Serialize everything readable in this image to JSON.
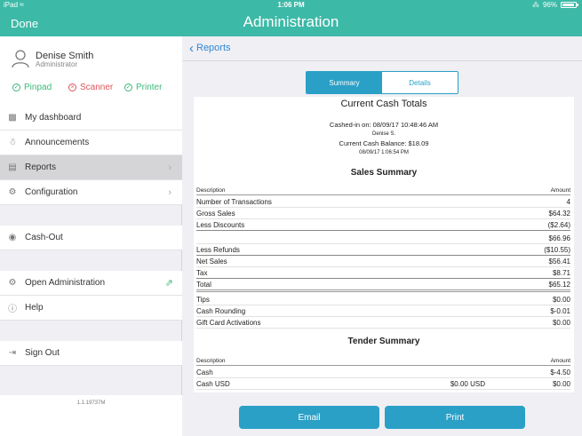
{
  "status": {
    "carrier": "iPad",
    "time": "1:06 PM",
    "battery": "96%",
    "battery_level": 0.96
  },
  "header": {
    "done_label": "Done",
    "title": "Administration"
  },
  "user": {
    "name": "Denise Smith",
    "role": "Administrator"
  },
  "devices": [
    {
      "label": "Pinpad",
      "ok": true
    },
    {
      "label": "Scanner",
      "ok": false
    },
    {
      "label": "Printer",
      "ok": true
    }
  ],
  "sidebar": {
    "items": [
      {
        "label": "My dashboard"
      },
      {
        "label": "Announcements"
      },
      {
        "label": "Reports"
      },
      {
        "label": "Configuration"
      },
      {
        "label": "Cash-Out"
      },
      {
        "label": "Open Administration"
      },
      {
        "label": "Help"
      },
      {
        "label": "Sign Out"
      }
    ],
    "version": "1.1.19737M"
  },
  "main": {
    "back_label": "Reports",
    "tabs": [
      {
        "label": "Summary"
      },
      {
        "label": "Details"
      }
    ],
    "report": {
      "title": "Current Cash Totals",
      "cashed_in": "Cashed-in on: 08/09/17 10:48:46 AM",
      "cashier": "Denise S.",
      "balance": "Current Cash Balance: $18.09",
      "printed_at": "08/09/17 1:06:54 PM",
      "sales_title": "Sales Summary",
      "sales_header": {
        "left": "Description",
        "right": "Amount"
      },
      "sales_rows": [
        {
          "l": "Number of Transactions",
          "r": "4"
        },
        {
          "l": "Gross Sales",
          "r": "$64.32"
        },
        {
          "l": "Less Discounts",
          "r": "($2.64)"
        },
        {
          "l": "",
          "r": "$66.96"
        },
        {
          "l": "Less Refunds",
          "r": "($10.55)"
        },
        {
          "l": "Net Sales",
          "r": "$56.41"
        },
        {
          "l": "Tax",
          "r": "$8.71"
        },
        {
          "l": "Total",
          "r": "$65.12"
        },
        {
          "l": "Tips",
          "r": "$0.00"
        },
        {
          "l": "Cash Rounding",
          "r": "$-0.01"
        },
        {
          "l": "Gift Card Activations",
          "r": "$0.00"
        }
      ],
      "tender_title": "Tender Summary",
      "tender_header": {
        "left": "Description",
        "right": "Amount"
      },
      "tender_rows": [
        {
          "l": "Cash",
          "m": "",
          "r": "$-4.50"
        },
        {
          "l": "Cash USD",
          "m": "$0.00 USD",
          "r": "$0.00"
        }
      ]
    },
    "email_label": "Email",
    "print_label": "Print"
  }
}
